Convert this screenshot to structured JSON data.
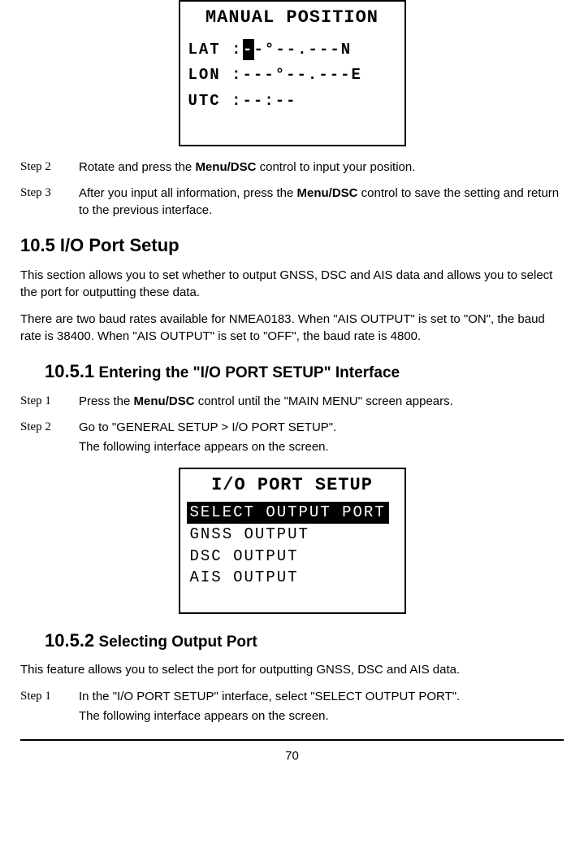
{
  "screen1": {
    "title": "MANUAL POSITION",
    "lat_label": "LAT",
    "lat_prefix": " :",
    "lat_cursor": "-",
    "lat_rest": "-°--.---N",
    "lon_label": "LON",
    "lon_value": " :---°--.---E",
    "utc_label": "UTC",
    "utc_value": " :--:--"
  },
  "step2_label": "Step 2",
  "step2_text_a": "Rotate and press the ",
  "step2_bold": "Menu/DSC",
  "step2_text_b": " control to input your position.",
  "step3_label": "Step 3",
  "step3_text_a": "After you input all information, press the ",
  "step3_bold": "Menu/DSC",
  "step3_text_b": " control to save the setting and return to the previous interface.",
  "section_10_5": "10.5 I/O Port Setup",
  "section_10_5_p1": "This section allows you to set whether to output GNSS, DSC and AIS data and allows you to select the port for outputting these data.",
  "section_10_5_p2": "There are two baud rates available for NMEA0183. When \"AIS OUTPUT\" is set to \"ON\", the baud rate is 38400. When \"AIS OUTPUT\" is set to \"OFF\", the baud rate is 4800.",
  "subsection_10_5_1_num": "10.5.1",
  "subsection_10_5_1_title": " Entering the \"I/O PORT SETUP\" Interface",
  "s1051_step1_label": "Step 1",
  "s1051_step1_a": "Press the ",
  "s1051_step1_bold": "Menu/DSC",
  "s1051_step1_b": " control until the \"MAIN MENU\" screen appears.",
  "s1051_step2_label": "Step 2",
  "s1051_step2_text": "Go to \"GENERAL SETUP > I/O PORT SETUP\".",
  "s1051_step2_p2": "The following interface appears on the screen.",
  "screen2": {
    "title": "I/O PORT SETUP",
    "item1": "SELECT OUTPUT PORT",
    "item2": "GNSS OUTPUT",
    "item3": "DSC OUTPUT",
    "item4": "AIS OUTPUT"
  },
  "subsection_10_5_2_num": "10.5.2",
  "subsection_10_5_2_title": " Selecting Output Port",
  "section_10_5_2_p1": "This feature allows you to select the port for outputting GNSS, DSC and AIS data.",
  "s1052_step1_label": "Step 1",
  "s1052_step1_text": "In the \"I/O PORT SETUP\" interface, select \"SELECT OUTPUT PORT\".",
  "s1052_step1_p2": "The following interface appears on the screen.",
  "page_number": "70"
}
